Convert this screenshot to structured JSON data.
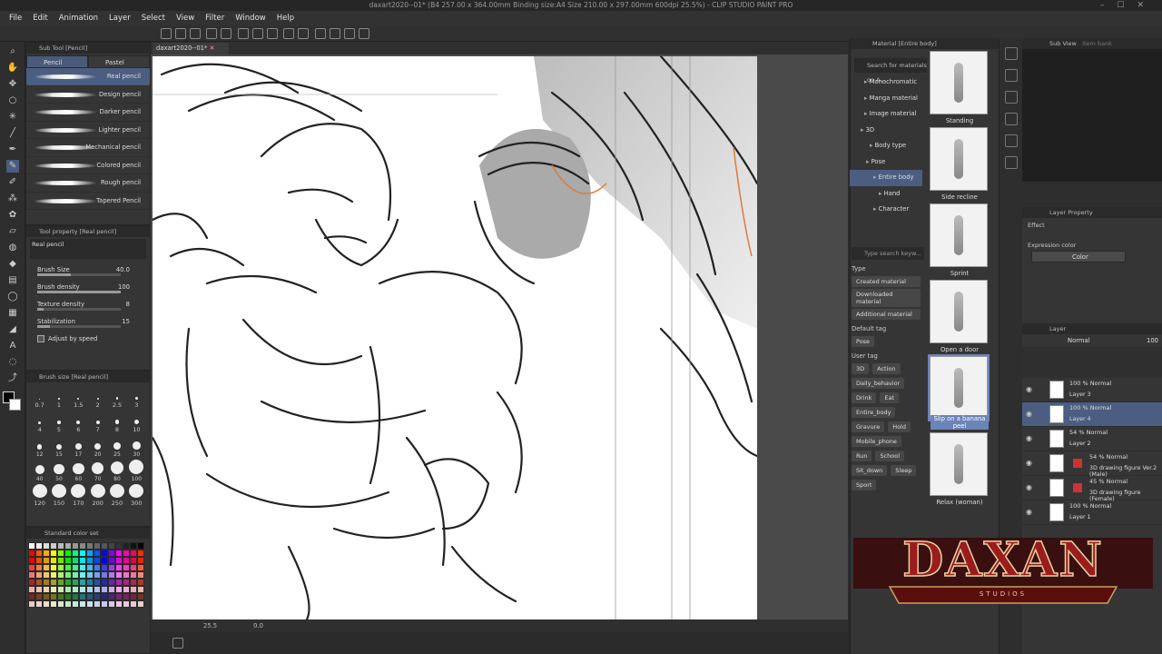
{
  "window": {
    "title": "daxart2020--01* (B4 257.00 x 364.00mm Binding size:A4 Size 210.00 x 297.00mm 600dpi 25.5%) - CLIP STUDIO PAINT PRO"
  },
  "menu": [
    "File",
    "Edit",
    "Animation",
    "Layer",
    "Select",
    "View",
    "Filter",
    "Window",
    "Help"
  ],
  "subtool": {
    "title": "Sub Tool [Pencil]",
    "tabs": [
      "Pencil",
      "Pastel"
    ],
    "brushes": [
      "Real pencil",
      "Design pencil",
      "Darker pencil",
      "Lighter pencil",
      "Mechanical pencil",
      "Colored pencil",
      "Rough pencil",
      "Tapered Pencil"
    ]
  },
  "toolprop": {
    "title": "Tool property [Real pencil]",
    "preset": "Real pencil",
    "rows": [
      {
        "label": "Brush Size",
        "value": "40.0",
        "fill": 0.4
      },
      {
        "label": "Brush density",
        "value": "100",
        "fill": 1.0
      },
      {
        "label": "Texture density",
        "value": "8",
        "fill": 0.08
      },
      {
        "label": "Stabilization",
        "value": "15",
        "fill": 0.15
      }
    ],
    "adjust": "Adjust by speed"
  },
  "brushsize": {
    "title": "Brush size [Real pencil]",
    "sizes": [
      "0.7",
      "1",
      "1.5",
      "2",
      "2.5",
      "3",
      "4",
      "5",
      "6",
      "7",
      "8",
      "10",
      "12",
      "15",
      "17",
      "20",
      "25",
      "30",
      "40",
      "50",
      "60",
      "70",
      "80",
      "100",
      "120",
      "150",
      "170",
      "200",
      "250",
      "300"
    ]
  },
  "colorset": {
    "title": "Standard color set"
  },
  "canvas": {
    "tab": "daxart2020--01*",
    "zoom": "25.5",
    "angle": "0.0"
  },
  "material": {
    "title": "Material [Entire body]",
    "search": "Search for materials on A...",
    "tree": [
      "Monochromatic",
      "Manga material",
      "Image material",
      "3D",
      "Body type",
      "Pose",
      "Entire body",
      "Hand",
      "Character"
    ],
    "keyword": "Type search keyw...",
    "type_head": "Type",
    "types": [
      "Created material",
      "Downloaded material",
      "Additional material"
    ],
    "default_head": "Default tag",
    "default_tags": [
      "Pose"
    ],
    "user_head": "User tag",
    "user_tags": [
      "3D",
      "Action",
      "Daily_behavior",
      "Drink",
      "Eat",
      "Entire_body",
      "Gravure",
      "Hold",
      "Mobile_phone",
      "Run",
      "School",
      "Sit_down",
      "Sleep",
      "Sport"
    ],
    "thumbs": [
      "Standing",
      "Side recline",
      "Sprint",
      "Open a door",
      "Slip on a banana peel",
      "Relax (woman)"
    ]
  },
  "subview": {
    "title": "Sub View",
    "tab2": "Item bank"
  },
  "layerprop": {
    "title": "Layer Property",
    "effect": "Effect",
    "expression_label": "Expression color",
    "expression_value": "Color"
  },
  "layers": {
    "title": "Layer",
    "blend": "Normal",
    "opacity": "100",
    "rows": [
      {
        "mode": "100 % Normal",
        "name": "Layer 3"
      },
      {
        "mode": "100 % Normal",
        "name": "Layer 4",
        "selected": true
      },
      {
        "mode": "54 % Normal",
        "name": "Layer 2"
      },
      {
        "mode": "54 % Normal",
        "name": "3D drawing figure Ver.2 (Male)"
      },
      {
        "mode": "45 % Normal",
        "name": "3D drawing figure (Female)"
      },
      {
        "mode": "100 % Normal",
        "name": "Layer 1"
      }
    ]
  },
  "logo": {
    "main": "DAXAN",
    "sub": "STUDIOS"
  },
  "colors": {
    "accent": "#4b5d80",
    "logo_red": "#9b1c1c"
  }
}
